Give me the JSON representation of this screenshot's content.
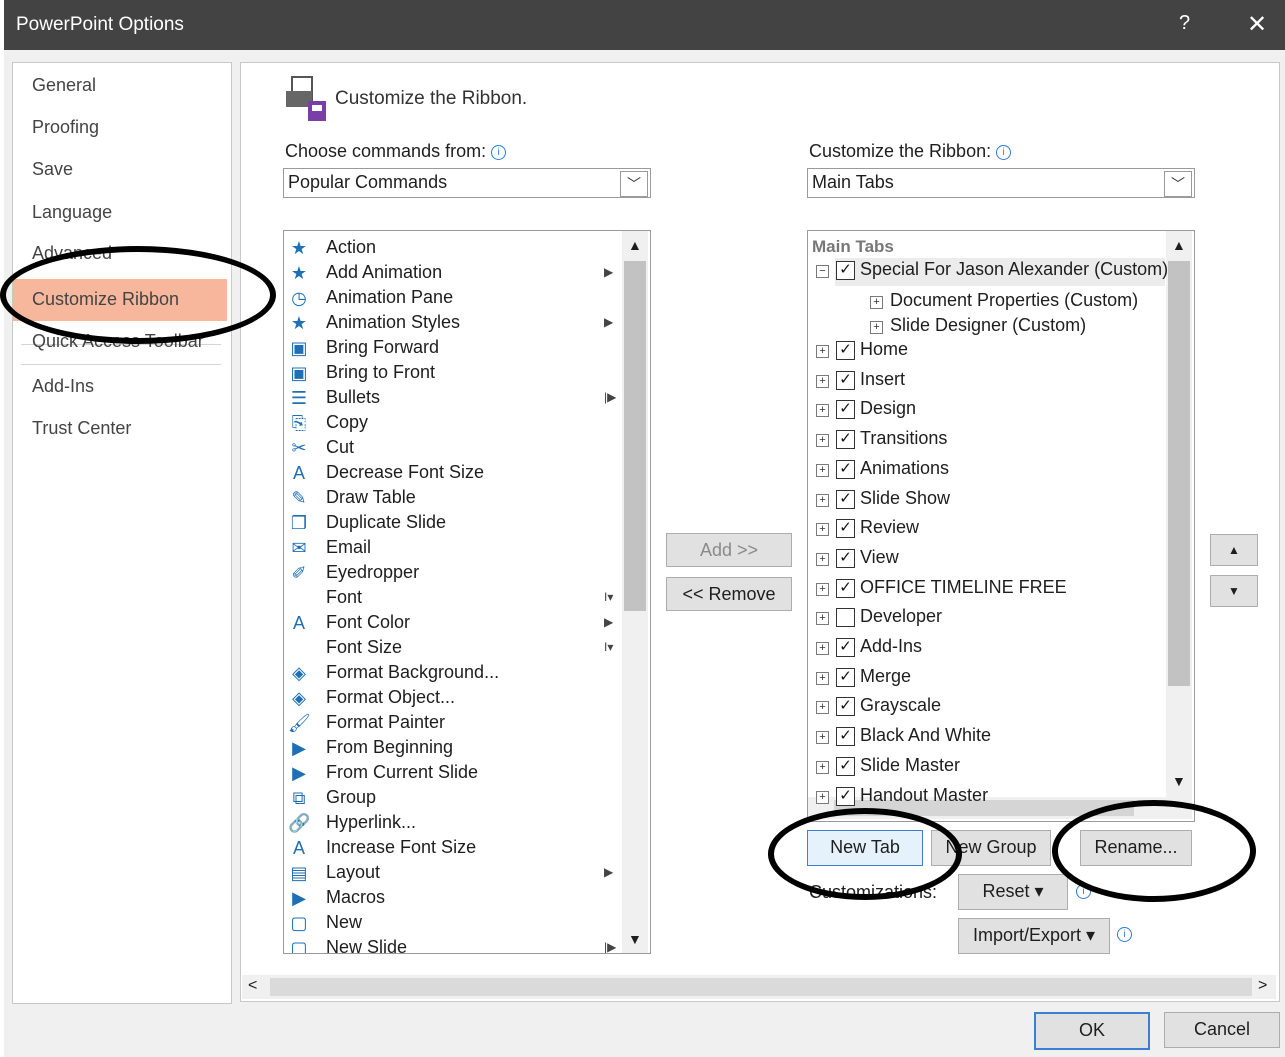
{
  "window": {
    "title": "PowerPoint Options",
    "help": "?",
    "close": "✕"
  },
  "nav": [
    {
      "label": "General"
    },
    {
      "label": "Proofing"
    },
    {
      "label": "Save"
    },
    {
      "label": "Language"
    },
    {
      "label": "Advanced"
    },
    {
      "label": "Customize Ribbon",
      "selected": true
    },
    {
      "label": "Quick Access Toolbar"
    },
    {
      "label": "Add-Ins"
    },
    {
      "label": "Trust Center"
    }
  ],
  "header": {
    "title": "Customize the Ribbon."
  },
  "left": {
    "label": "Choose commands from:",
    "dropdown_value": "Popular Commands",
    "commands": [
      {
        "label": "Action",
        "icon": "action-icon",
        "glyph": "★"
      },
      {
        "label": "Add Animation",
        "icon": "add-animation-icon",
        "glyph": "★",
        "sub": "▶"
      },
      {
        "label": "Animation Pane",
        "icon": "animation-pane-icon",
        "glyph": "◷"
      },
      {
        "label": "Animation Styles",
        "icon": "animation-styles-icon",
        "glyph": "★",
        "sub": "▶"
      },
      {
        "label": "Bring Forward",
        "icon": "bring-forward-icon",
        "glyph": "▣"
      },
      {
        "label": "Bring to Front",
        "icon": "bring-to-front-icon",
        "glyph": "▣"
      },
      {
        "label": "Bullets",
        "icon": "bullets-icon",
        "glyph": "☰",
        "sub": "|▶"
      },
      {
        "label": "Copy",
        "icon": "copy-icon",
        "glyph": "⎘"
      },
      {
        "label": "Cut",
        "icon": "cut-icon",
        "glyph": "✂"
      },
      {
        "label": "Decrease Font Size",
        "icon": "decrease-font-icon",
        "glyph": "A"
      },
      {
        "label": "Draw Table",
        "icon": "draw-table-icon",
        "glyph": "✎"
      },
      {
        "label": "Duplicate Slide",
        "icon": "duplicate-slide-icon",
        "glyph": "❐"
      },
      {
        "label": "Email",
        "icon": "email-icon",
        "glyph": "✉"
      },
      {
        "label": "Eyedropper",
        "icon": "eyedropper-icon",
        "glyph": "✐"
      },
      {
        "label": "Font",
        "icon": "font-icon",
        "glyph": "",
        "sub": "I▾"
      },
      {
        "label": "Font Color",
        "icon": "font-color-icon",
        "glyph": "A",
        "sub": "▶"
      },
      {
        "label": "Font Size",
        "icon": "font-size-icon",
        "glyph": "",
        "sub": "I▾"
      },
      {
        "label": "Format Background...",
        "icon": "format-background-icon",
        "glyph": "◈"
      },
      {
        "label": "Format Object...",
        "icon": "format-object-icon",
        "glyph": "◈"
      },
      {
        "label": "Format Painter",
        "icon": "format-painter-icon",
        "glyph": "🖌"
      },
      {
        "label": "From Beginning",
        "icon": "from-beginning-icon",
        "glyph": "▶"
      },
      {
        "label": "From Current Slide",
        "icon": "from-current-slide-icon",
        "glyph": "▶"
      },
      {
        "label": "Group",
        "icon": "group-icon",
        "glyph": "⧉"
      },
      {
        "label": "Hyperlink...",
        "icon": "hyperlink-icon",
        "glyph": "🔗"
      },
      {
        "label": "Increase Font Size",
        "icon": "increase-font-icon",
        "glyph": "A"
      },
      {
        "label": "Layout",
        "icon": "layout-icon",
        "glyph": "▤",
        "sub": "▶"
      },
      {
        "label": "Macros",
        "icon": "macros-icon",
        "glyph": "▶"
      },
      {
        "label": "New",
        "icon": "new-icon",
        "glyph": "▢"
      },
      {
        "label": "New Slide",
        "icon": "new-slide-icon",
        "glyph": "▢",
        "sub": "|▶"
      }
    ]
  },
  "mid": {
    "add": "Add >>",
    "remove": "<< Remove"
  },
  "right": {
    "label": "Customize the Ribbon:",
    "dropdown_value": "Main Tabs",
    "tree_header": "Main Tabs",
    "special": "Special For Jason Alexander (Custom)",
    "special_children": [
      "Document Properties (Custom)",
      "Slide Designer (Custom)"
    ],
    "tabs": [
      {
        "label": "Home",
        "checked": true
      },
      {
        "label": "Insert",
        "checked": true
      },
      {
        "label": "Design",
        "checked": true
      },
      {
        "label": "Transitions",
        "checked": true
      },
      {
        "label": "Animations",
        "checked": true
      },
      {
        "label": "Slide Show",
        "checked": true
      },
      {
        "label": "Review",
        "checked": true
      },
      {
        "label": "View",
        "checked": true
      },
      {
        "label": "OFFICE TIMELINE FREE",
        "checked": true
      },
      {
        "label": "Developer",
        "checked": false
      },
      {
        "label": "Add-Ins",
        "checked": true
      },
      {
        "label": "Merge",
        "checked": true
      },
      {
        "label": "Grayscale",
        "checked": true
      },
      {
        "label": "Black And White",
        "checked": true
      },
      {
        "label": "Slide Master",
        "checked": true
      },
      {
        "label": "Handout Master",
        "checked": true
      }
    ],
    "new_tab": "New Tab",
    "new_group": "New Group",
    "rename": "Rename...",
    "customizations": "Customizations:",
    "reset": "Reset ▾",
    "import_export": "Import/Export ▾"
  },
  "footer": {
    "ok": "OK",
    "cancel": "Cancel"
  }
}
